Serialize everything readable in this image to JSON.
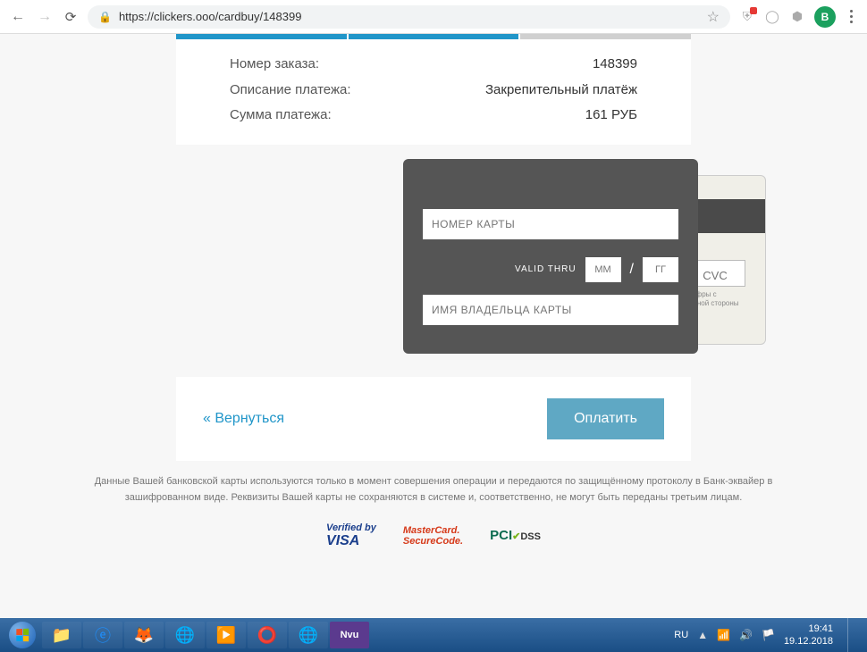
{
  "browser": {
    "url": "https://clickers.ooo/cardbuy/148399",
    "profile_initial": "В",
    "ext_badge_count": "1"
  },
  "order": {
    "number_label": "Номер заказа:",
    "number_value": "148399",
    "desc_label": "Описание платежа:",
    "desc_value": "Закрепительный платёж",
    "sum_label": "Сумма платежа:",
    "sum_value": "161 РУБ"
  },
  "card": {
    "number_placeholder": "НОМЕР КАРТЫ",
    "valid_thru_label": "VALID THRU",
    "month_placeholder": "ММ",
    "year_placeholder": "ГГ",
    "name_placeholder": "ИМЯ ВЛАДЕЛЬЦА КАРТЫ",
    "cvc_placeholder": "CVC",
    "cvc_hint": "Три цифры с оборотной стороны карты"
  },
  "actions": {
    "back": "« Вернуться",
    "pay": "Оплатить"
  },
  "disclaimer": "Данные Вашей банковской карты используются только в момент совершения операции и передаются по защищённому протоколу в Банк-эквайер в зашифрованном виде. Реквизиты Вашей карты не сохраняются в системе и, соответственно, не могут быть переданы третьим лицам.",
  "logos": {
    "visa_line1": "Verified by",
    "visa_line2": "VISA",
    "mc_line1": "MasterCard.",
    "mc_line2": "SecureCode.",
    "pci_1": "PCI",
    "pci_2": "DSS"
  },
  "taskbar": {
    "lang": "RU",
    "time": "19:41",
    "date": "19.12.2018"
  }
}
